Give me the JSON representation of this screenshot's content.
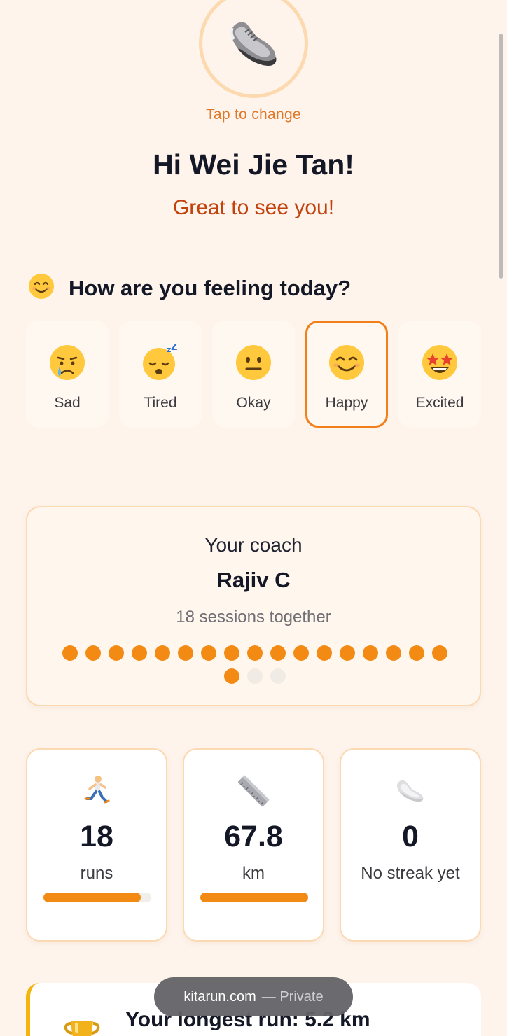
{
  "profile": {
    "avatar_icon": "sneaker-icon",
    "tap_to_change": "Tap to change",
    "greeting": "Hi Wei Jie Tan!",
    "subgreeting": "Great to see you!"
  },
  "mood": {
    "header_icon": "smiling-face-icon",
    "title": "How are you feeling today?",
    "options": [
      {
        "label": "Sad",
        "icon": "crying-face-icon",
        "selected": false
      },
      {
        "label": "Tired",
        "icon": "sleeping-face-icon",
        "selected": false
      },
      {
        "label": "Okay",
        "icon": "neutral-face-icon",
        "selected": false
      },
      {
        "label": "Happy",
        "icon": "smiling-face-icon",
        "selected": true
      },
      {
        "label": "Excited",
        "icon": "star-struck-face-icon",
        "selected": false
      }
    ]
  },
  "coach": {
    "title": "Your coach",
    "name": "Rajiv C",
    "sessions_text": "18 sessions together",
    "sessions_completed": 18,
    "sessions_total": 20
  },
  "stats": [
    {
      "icon": "runner-icon",
      "value": "18",
      "label": "runs",
      "progress": 0.9
    },
    {
      "icon": "ruler-icon",
      "value": "67.8",
      "label": "km",
      "progress": 1.0
    },
    {
      "icon": "sneaker-icon",
      "value": "0",
      "label": "No streak yet",
      "progress": null
    }
  ],
  "longest_run": {
    "icon": "trophy-icon",
    "title": "Your longest run: 5.2 km"
  },
  "browser": {
    "domain": "kitarun.com",
    "mode": "— Private"
  },
  "colors": {
    "background": "#FEF4EC",
    "accent": "#F28A14",
    "accent_text": "#C2410C",
    "card_border": "#FBD9B2"
  }
}
